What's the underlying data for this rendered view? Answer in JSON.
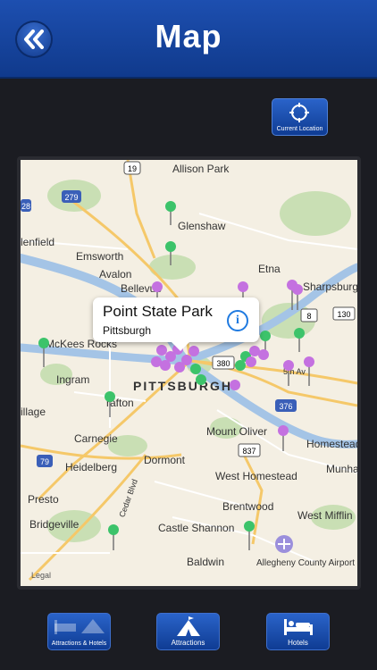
{
  "header": {
    "title": "Map",
    "back_icon": "double-chevron-left-icon"
  },
  "current_location": {
    "label": "Current Location",
    "icon": "crosshair-icon"
  },
  "map": {
    "labels": [
      "Allison Park",
      "Glenshaw",
      "Etna",
      "Emsworth",
      "Avalon",
      "Bellevue",
      "lenfield",
      "Sharpsburg",
      "McKees Rocks",
      "Ingram",
      "PITTSBURGH",
      "Carnegie",
      "Heidelberg",
      "Dormont",
      "Mount Oliver",
      "Homestead",
      "West Homestead",
      "Munhall",
      "Presto",
      "Bridgeville",
      "Brentwood",
      "West Mifflin",
      "Castle Shannon",
      "Baldwin",
      "Allegheny County Airport",
      "illage",
      "rafton",
      "Cedar Blvd",
      "5th Av",
      "Legal"
    ],
    "shields": [
      "19",
      "279",
      "28",
      "8",
      "130",
      "380",
      "376",
      "79",
      "837"
    ]
  },
  "popup": {
    "title": "Point State Park",
    "subtitle": "Pittsburgh"
  },
  "tabs": [
    {
      "label": "Attractions & Hotels",
      "icon": "bed-tent-icon"
    },
    {
      "label": "Attractions",
      "icon": "tent-icon"
    },
    {
      "label": "Hotels",
      "icon": "bed-icon"
    }
  ]
}
